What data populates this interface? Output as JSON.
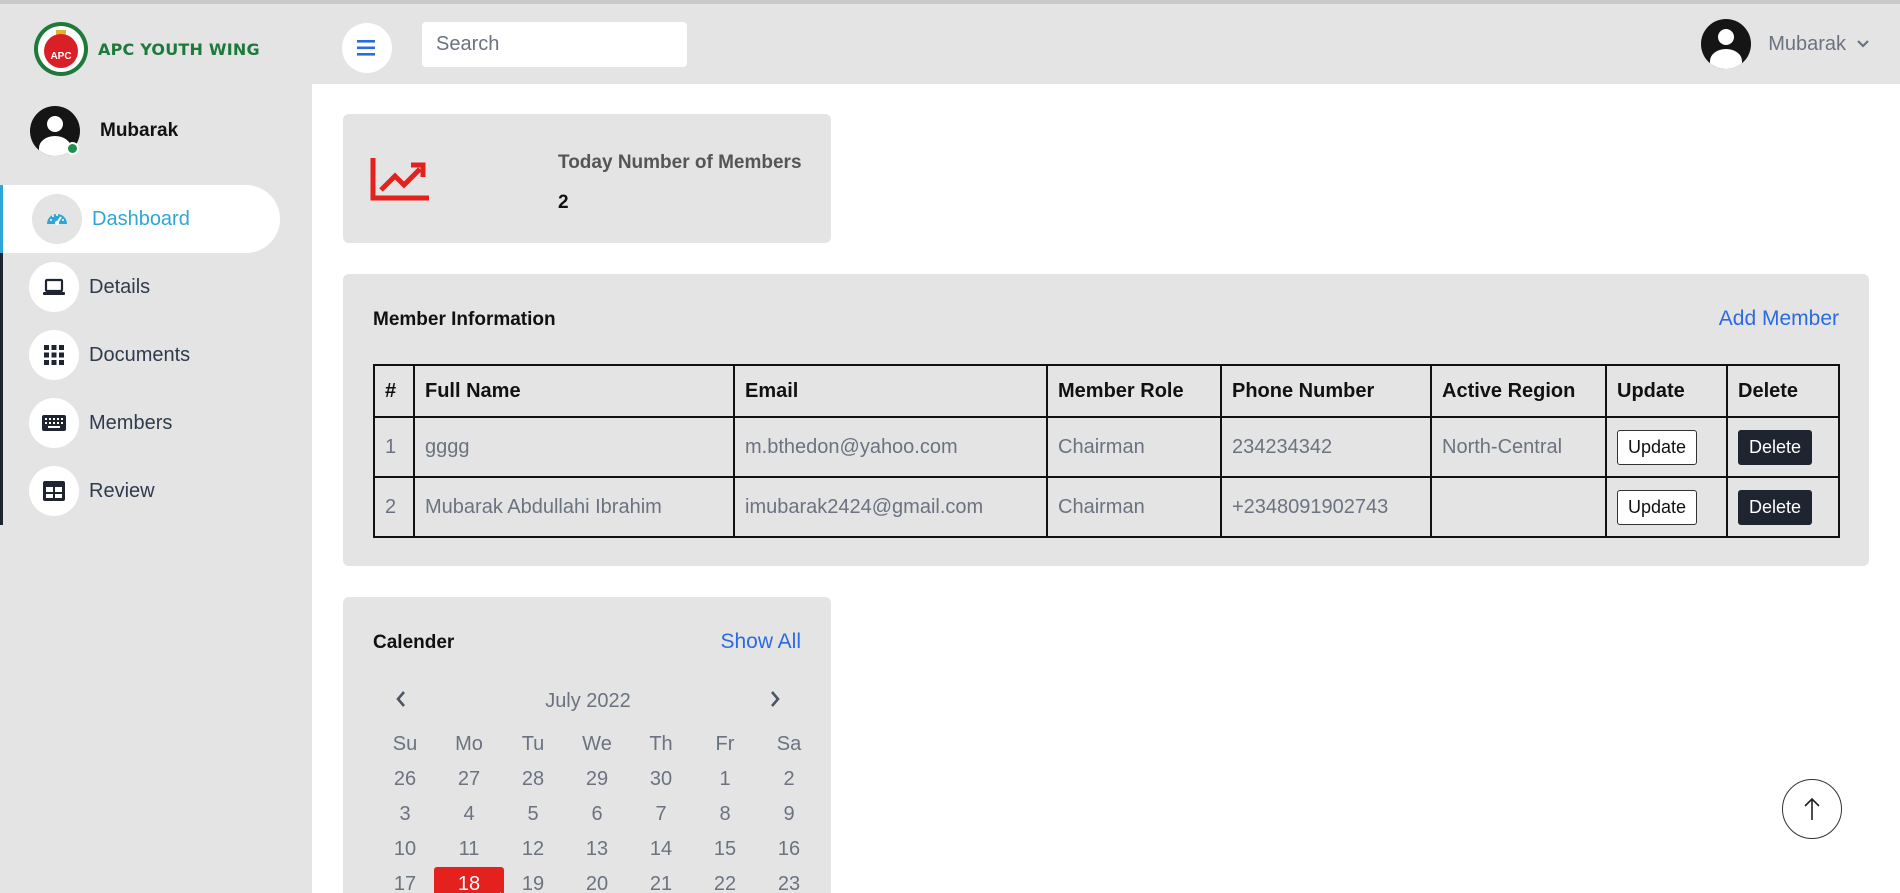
{
  "brand": {
    "name": "APC YOUTH WING",
    "badge_text": "APC",
    "primary_color": "#1d7a3a",
    "accent_red": "#d92027"
  },
  "sidebar": {
    "user_name": "Mubarak",
    "items": [
      {
        "label": "Dashboard",
        "icon": "speedometer-icon",
        "active": true
      },
      {
        "label": "Details",
        "icon": "laptop-icon",
        "active": false
      },
      {
        "label": "Documents",
        "icon": "grid-icon",
        "active": false
      },
      {
        "label": "Members",
        "icon": "keyboard-icon",
        "active": false
      },
      {
        "label": "Review",
        "icon": "table-icon",
        "active": false
      }
    ]
  },
  "header": {
    "search_placeholder": "Search",
    "user_name": "Mubarak"
  },
  "stats": {
    "label": "Today Number of Members",
    "value": "2",
    "icon": "trending-up-icon",
    "icon_color": "#e5211d"
  },
  "members": {
    "title": "Member Information",
    "add_label": "Add Member",
    "columns": [
      "#",
      "Full Name",
      "Email",
      "Member Role",
      "Phone Number",
      "Active Region",
      "Update",
      "Delete"
    ],
    "rows": [
      {
        "num": "1",
        "full_name": "gggg",
        "email": "m.bthedon@yahoo.com",
        "role": "Chairman",
        "phone": "234234342",
        "region": "North-Central",
        "update_label": "Update",
        "delete_label": "Delete"
      },
      {
        "num": "2",
        "full_name": "Mubarak Abdullahi Ibrahim",
        "email": "imubarak2424@gmail.com",
        "role": "Chairman",
        "phone": "+2348091902743",
        "region": "",
        "update_label": "Update",
        "delete_label": "Delete"
      }
    ]
  },
  "calendar": {
    "title": "Calender",
    "show_all_label": "Show All",
    "month_label": "July 2022",
    "weekdays": [
      "Su",
      "Mo",
      "Tu",
      "We",
      "Th",
      "Fr",
      "Sa"
    ],
    "weeks": [
      [
        "26",
        "27",
        "28",
        "29",
        "30",
        "1",
        "2"
      ],
      [
        "3",
        "4",
        "5",
        "6",
        "7",
        "8",
        "9"
      ],
      [
        "10",
        "11",
        "12",
        "13",
        "14",
        "15",
        "16"
      ],
      [
        "17",
        "18",
        "19",
        "20",
        "21",
        "22",
        "23"
      ]
    ],
    "selected_day": "18",
    "selected_color": "#e5211d"
  }
}
